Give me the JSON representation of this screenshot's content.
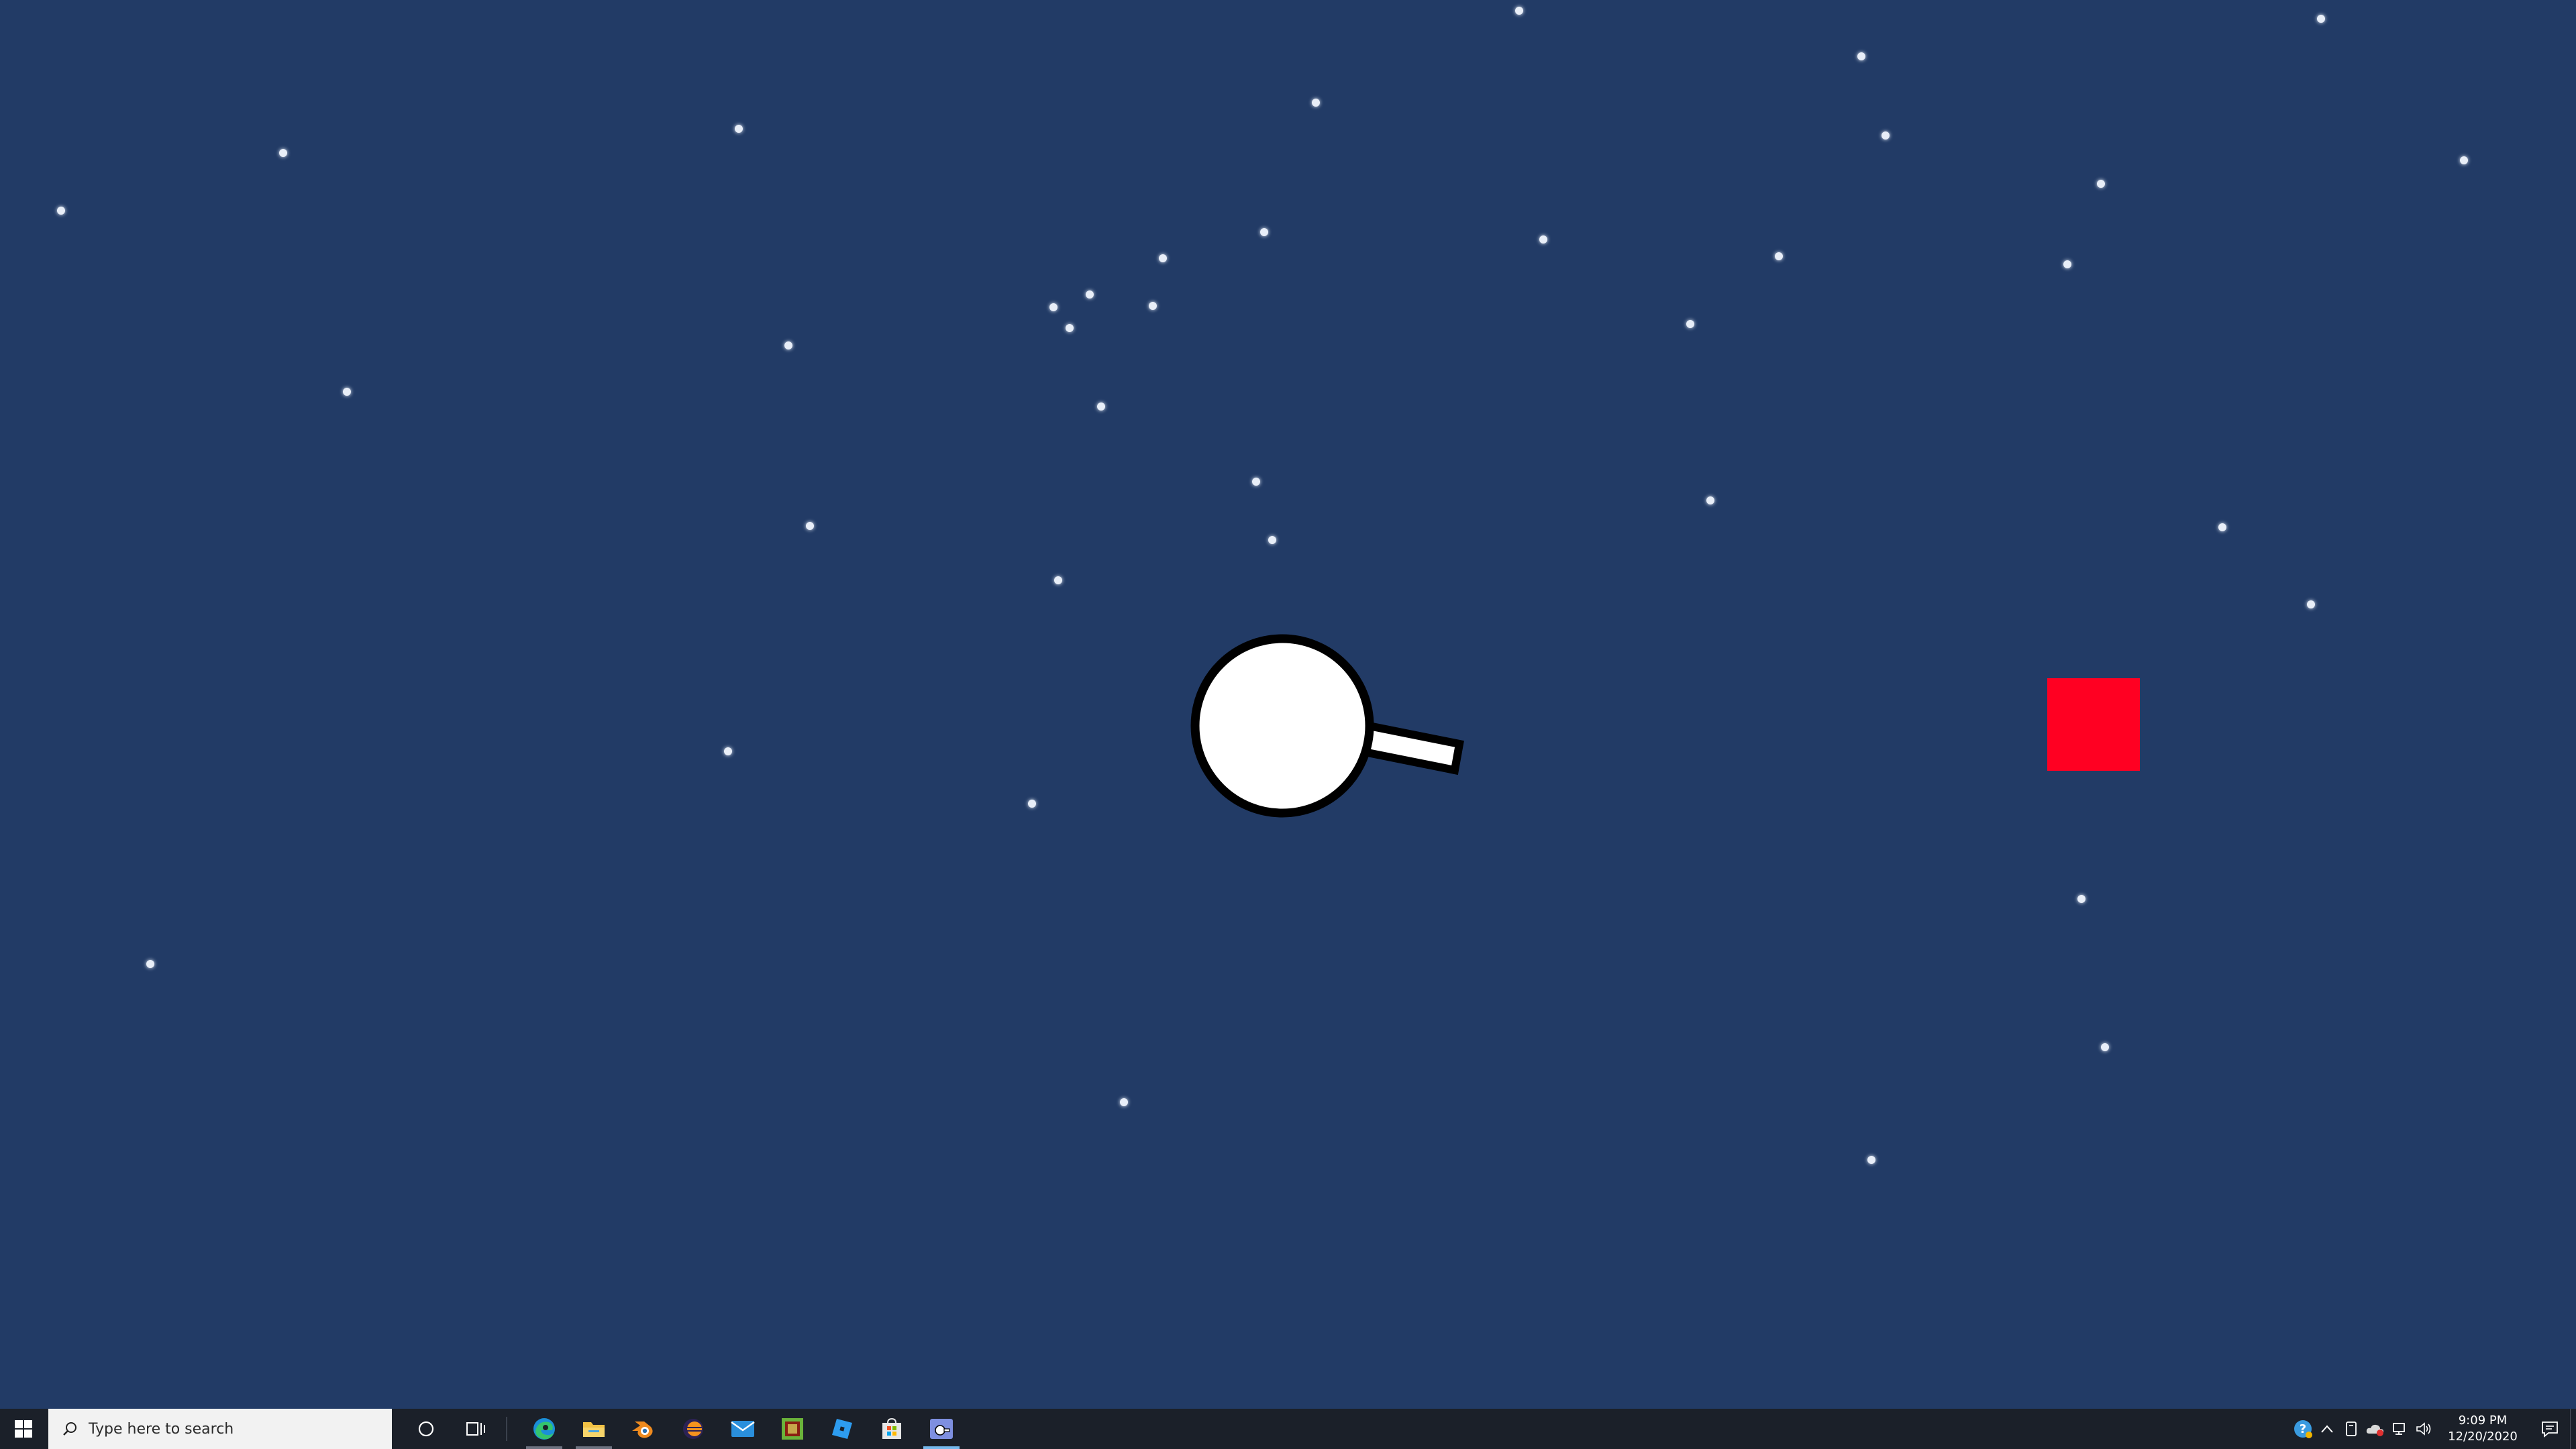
{
  "game": {
    "background_color": "#223b66",
    "star_color": "#e8eef8",
    "player": {
      "body_color": "#ffffff",
      "outline_color": "#000000",
      "barrel_color": "#ffffff"
    },
    "enemy": {
      "shape": "square",
      "color": "#ff0022"
    }
  },
  "taskbar": {
    "background_color": "#1b2029",
    "search": {
      "placeholder": "Type here to search"
    },
    "pinned_apps": [
      {
        "name": "edge-icon",
        "state": "open"
      },
      {
        "name": "file-explorer-icon",
        "state": "open"
      },
      {
        "name": "blender-icon",
        "state": "none"
      },
      {
        "name": "eclipse-icon",
        "state": "none"
      },
      {
        "name": "mail-icon",
        "state": "none"
      },
      {
        "name": "minecraft-icon",
        "state": "none"
      },
      {
        "name": "roblox-studio-icon",
        "state": "none"
      },
      {
        "name": "store-icon",
        "state": "none"
      },
      {
        "name": "game-window-icon",
        "state": "active"
      }
    ],
    "clock": {
      "time": "9:09 PM",
      "date": "12/20/2020"
    }
  }
}
